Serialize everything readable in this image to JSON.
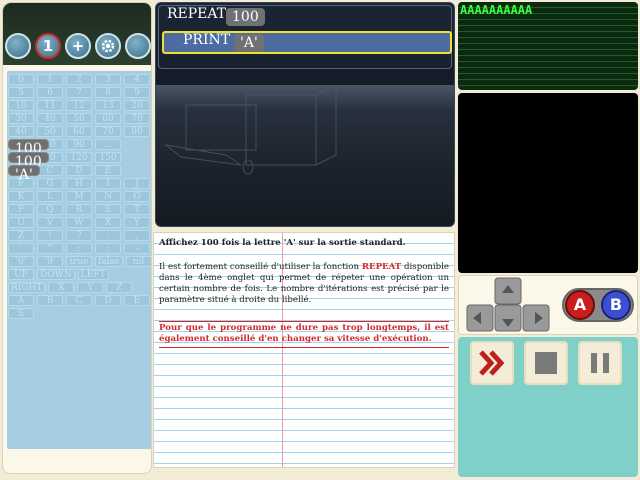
{
  "toolbar": {
    "button2_label": "1",
    "button3_label": "+"
  },
  "palette": {
    "rows": [
      [
        "0",
        "1",
        "2",
        "3",
        "4"
      ],
      [
        "5",
        "6",
        "7",
        "8",
        "9"
      ],
      [
        "10",
        "11",
        "12",
        "13",
        "20"
      ],
      [
        "30",
        "40",
        "50",
        "60",
        "70"
      ],
      [
        "40",
        "50",
        "60",
        "70",
        "80"
      ],
      [
        "60",
        "80",
        "90",
        "100",
        "..."
      ],
      [
        "80",
        "90",
        "100",
        "120",
        "150"
      ],
      [
        "'A'",
        "B",
        "C",
        "D",
        "E"
      ],
      [
        "F",
        "G",
        "H",
        "I",
        "J"
      ],
      [
        "K",
        "L",
        "M",
        "N",
        "O"
      ],
      [
        "P",
        "Q",
        "R",
        "S",
        "T"
      ],
      [
        "U",
        "V",
        "W",
        "X",
        "Y"
      ],
      [
        "Z",
        "!",
        "?",
        ".",
        ","
      ],
      [
        "'",
        "\"",
        ":",
        ";",
        "-"
      ],
      [
        "'0'",
        "'9'",
        "true",
        "false",
        "nil"
      ],
      [
        "UP",
        "DOWN",
        "LEFT"
      ],
      [
        "RIGHT",
        "X",
        "Y",
        "Z"
      ],
      [
        "A",
        "B",
        "C",
        "D",
        "E"
      ],
      [
        "S"
      ]
    ],
    "highlighted": [
      "100",
      "'A'"
    ]
  },
  "editor": {
    "line1_keyword": "REPEAT",
    "line1_value": "100",
    "line2_keyword": "PRINT",
    "line2_value": "'A'"
  },
  "instructions": {
    "title": "Affichez 100 fois la lettre 'A' sur la sortie standard.",
    "p1_before": "Il est fortement conseillé d'utiliser la fonction ",
    "p1_keyword": "REPEAT",
    "p1_after": " disponible dans le 4ème onglet qui permet de répeter une opération un certain nombre de fois. Le nombre d'itérations est précisé par le paramètre situé à droite du libellé.",
    "p2": "Pour que le programme ne dure pas trop longtemps, il est également conseillé d'en changer sa vitesse d'exécution."
  },
  "output": {
    "text": "AAAAAAAAAA"
  },
  "gamepad": {
    "a_label": "A",
    "b_label": "B"
  },
  "colors": {
    "accent_red": "#d42a2a",
    "output_green": "#38ff3a",
    "editor_highlight": "#f0e12e",
    "controls_teal": "#7fd0c8"
  }
}
